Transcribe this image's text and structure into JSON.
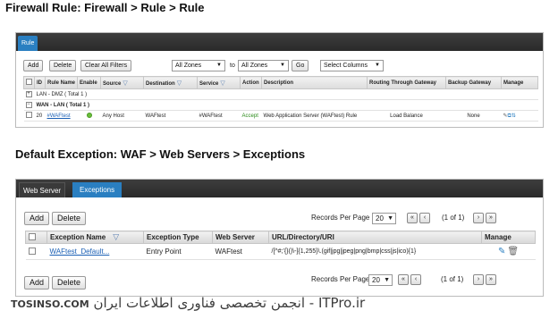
{
  "headings": {
    "firewall": "Firewall Rule: Firewall > Rule > Rule",
    "exception": "Default Exception: WAF > Web Servers > Exceptions"
  },
  "rule_panel": {
    "tab": "Rule",
    "toolbar": {
      "add": "Add",
      "delete": "Delete",
      "clear_filters": "Clear All Filters",
      "zone_from": "All Zones",
      "to_label": "to",
      "zone_to": "All Zones",
      "go": "Go",
      "select_columns": "Select Columns"
    },
    "columns": [
      "ID",
      "Rule Name",
      "Enable",
      "Source",
      "Destination",
      "Service",
      "Action",
      "Description",
      "Routing Through Gateway",
      "Backup Gateway",
      "Manage"
    ],
    "groups": [
      {
        "label": "LAN - DMZ ( Total 1 )"
      },
      {
        "label": "WAN - LAN ( Total 1 )"
      }
    ],
    "row": {
      "id": "20",
      "rule_name": "#WAFtest",
      "source": "Any Host",
      "destination": "WAFtest",
      "service": "#WAFtest",
      "action": "Accept",
      "description": "Web Application Server (WAFtest) Rule",
      "routing_gateway": "Load Balance",
      "backup_gateway": "None"
    }
  },
  "exception_panel": {
    "tabs": [
      "Web Server",
      "Exceptions"
    ],
    "add": "Add",
    "delete": "Delete",
    "records_label": "Records Per Page",
    "records_value": "20",
    "page_info": "(1 of 1)",
    "columns": [
      "Exception Name",
      "Exception Type",
      "Web Server",
      "URL/Directory/URI",
      "Manage"
    ],
    "row": {
      "name": "WAFtest_Default...",
      "type": "Entry Point",
      "web_server": "WAFtest",
      "uri": "/[^#;'{}()\\-]{1,255}\\.(gif|jpg|jpeg|png|bmp|css|js|ico){1}"
    }
  },
  "watermark": {
    "site1": "TOSINSO.COM",
    "text": "انجمن تخصصی فناوری اطلاعات ایران - ITPro.ir"
  },
  "colors": {
    "tab_active": "#2a7fc1",
    "bar_dark": "#333333",
    "link": "#1a5fb4",
    "accept": "#2a8a1a"
  }
}
